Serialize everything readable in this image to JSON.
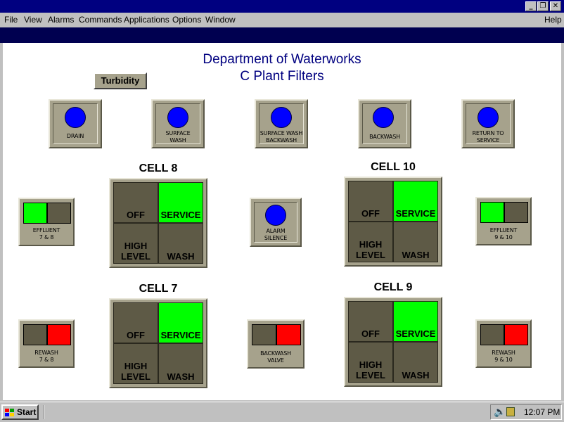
{
  "menu": {
    "file": "File",
    "view": "View",
    "alarms": "Alarms",
    "commands": "Commands",
    "applications": "Applications",
    "options": "Options",
    "window": "Window",
    "help": "Help"
  },
  "header": {
    "title_line1": "Department of Waterworks",
    "title_line2": "C Plant Filters"
  },
  "turbidity_label": "Turbidity",
  "top_buttons": [
    {
      "line1": "DRAIN",
      "line2": ""
    },
    {
      "line1": "SURFACE",
      "line2": "WASH"
    },
    {
      "line1": "SURFACE WASH",
      "line2": "BACKWASH"
    },
    {
      "line1": "BACKWASH",
      "line2": ""
    },
    {
      "line1": "RETURN TO",
      "line2": "SERVICE"
    }
  ],
  "alarm_silence": {
    "line1": "ALARM",
    "line2": "SILENCE"
  },
  "valves": {
    "effluent_7_8": {
      "line1": "EFFLUENT",
      "line2": "7 & 8"
    },
    "effluent_9_10": {
      "line1": "EFFLUENT",
      "line2": "9 & 10"
    },
    "rewash_7_8": {
      "line1": "REWASH",
      "line2": "7 & 8"
    },
    "rewash_9_10": {
      "line1": "REWASH",
      "line2": "9 & 10"
    },
    "backwash_valve": {
      "line1": "BACKWASH",
      "line2": "VALVE"
    }
  },
  "cells": {
    "cell8": {
      "title": "CELL 8"
    },
    "cell10": {
      "title": "CELL 10"
    },
    "cell7": {
      "title": "CELL 7"
    },
    "cell9": {
      "title": "CELL 9"
    }
  },
  "modes": {
    "off": "OFF",
    "service": "SERVICE",
    "high": "HIGH",
    "level": "LEVEL",
    "wash": "WASH"
  },
  "colors": {
    "on_green": "#00ff00",
    "alarm_red": "#ff0000",
    "off_olive": "#5e5a46",
    "led_blue": "#0000ff"
  },
  "taskbar": {
    "start_label": "Start",
    "clock": "12:07 PM"
  }
}
